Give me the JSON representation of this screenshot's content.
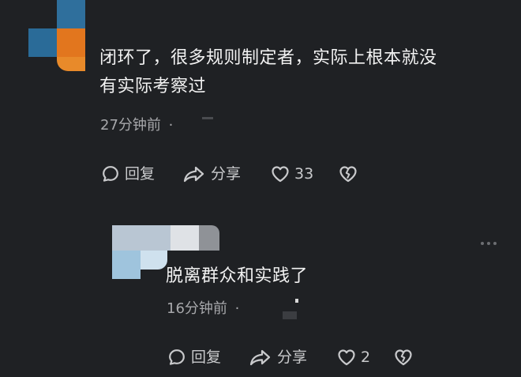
{
  "comments": [
    {
      "text_line1": "闭环了，很多规则制定者，实际上根本就没",
      "text_line2": "有实际考察过",
      "time": "27分钟前",
      "separator": "·",
      "actions": {
        "reply_label": "回复",
        "share_label": "分享",
        "like_count": "33"
      }
    },
    {
      "text_line1": "脱离群众和实践了",
      "time": "16分钟前",
      "separator": "·",
      "actions": {
        "reply_label": "回复",
        "share_label": "分享",
        "like_count": "2"
      }
    }
  ],
  "colors": {
    "background": "#1f2124",
    "text": "#f2f2f2",
    "meta": "#a7a8ab",
    "icon": "#c9cacc"
  },
  "icons": {
    "reply": "speech-bubble-icon",
    "share": "share-arrow-icon",
    "like": "heart-icon",
    "dislike": "broken-heart-icon",
    "more": "more-dots-icon"
  }
}
